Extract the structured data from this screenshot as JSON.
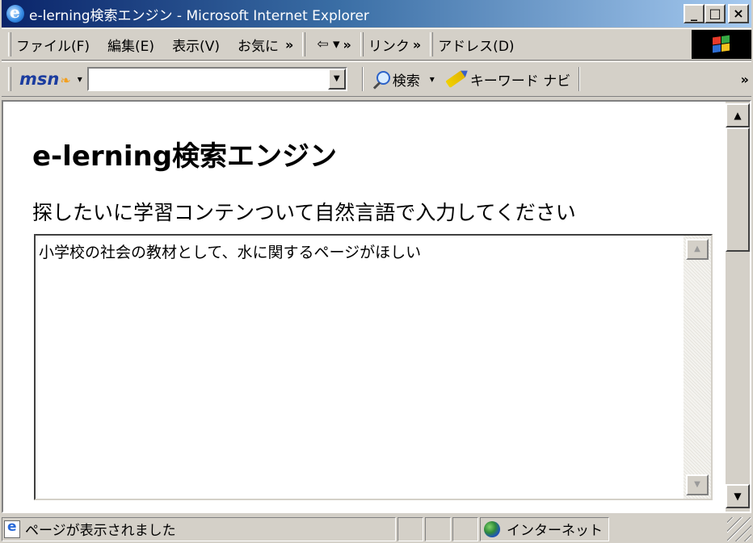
{
  "window": {
    "title": "e-lerning検索エンジン - Microsoft Internet Explorer",
    "minimize_glyph": "_",
    "maximize_glyph": "□",
    "close_glyph": "×"
  },
  "menubar": {
    "items": [
      "ファイル(F)",
      "編集(E)",
      "表示(V)",
      "お気に"
    ],
    "more_glyph": "»",
    "back_label": "⇦ ▾",
    "links_label": "リンク",
    "address_label": "アドレス(D)"
  },
  "msn_toolbar": {
    "logo": "msn",
    "dropdown_glyph": "▾",
    "search_value": "",
    "search_label": "検索",
    "keyword_label": "キーワード ナビ",
    "more_glyph": "»"
  },
  "page": {
    "heading": "e-lerning検索エンジン",
    "prompt": "探したいに学習コンテンついて自然言語で入力してください",
    "query_text": "小学校の社会の教材として、水に関するページがほしい"
  },
  "status": {
    "message": "ページが表示されました",
    "zone": "インターネット"
  },
  "icons": [
    "ie-logo-icon",
    "windows-logo-icon",
    "msn-butterfly-icon",
    "search-icon",
    "highlighter-icon",
    "page-done-icon",
    "globe-icon"
  ]
}
